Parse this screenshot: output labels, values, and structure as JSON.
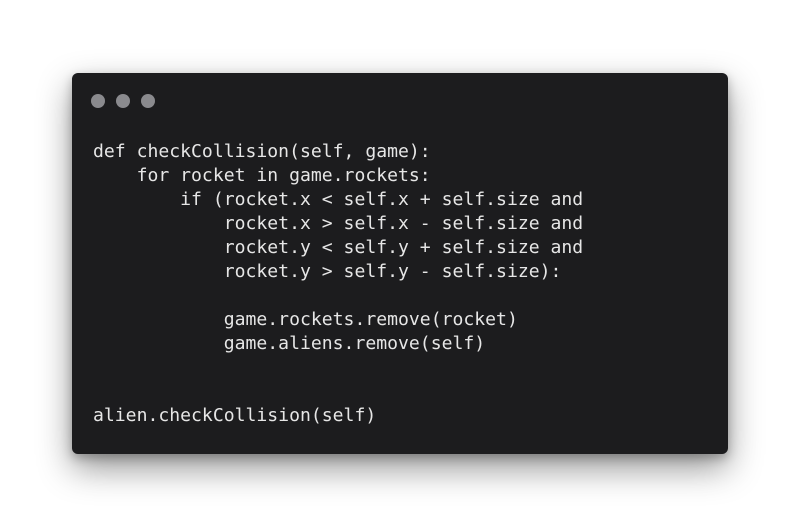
{
  "window": {
    "controls": [
      "close",
      "minimize",
      "maximize"
    ]
  },
  "code": {
    "language": "python",
    "lines": [
      "def checkCollision(self, game):",
      "    for rocket in game.rockets:",
      "        if (rocket.x < self.x + self.size and",
      "            rocket.x > self.x - self.size and",
      "            rocket.y < self.y + self.size and",
      "            rocket.y > self.y - self.size):",
      "",
      "            game.rockets.remove(rocket)",
      "            game.aliens.remove(self)",
      "",
      "",
      "alien.checkCollision(self)"
    ]
  },
  "colors": {
    "background": "#ffffff",
    "window": "#1c1c1e",
    "window_dots": "#8a8a8e",
    "code_text": "#e6e6e6"
  }
}
